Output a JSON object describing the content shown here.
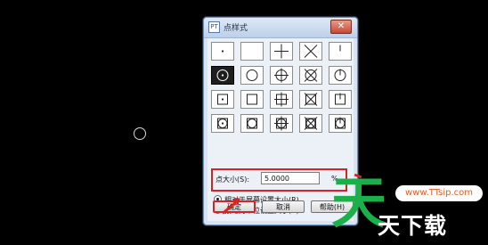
{
  "dialog": {
    "title": "点样式",
    "close_glyph": "✕",
    "icon_glyph": "PT"
  },
  "point_styles": {
    "selected_index": 5,
    "items": [
      "dot",
      "none",
      "plus",
      "x-cross",
      "tick",
      "circle-dot",
      "circle",
      "circle-plus",
      "circle-x",
      "circle-tick",
      "square-dot",
      "square",
      "square-plus",
      "square-x",
      "square-tick",
      "square-circle-dot",
      "square-circle",
      "square-circle-plus",
      "square-circle-x",
      "square-circle-tick"
    ]
  },
  "point_size": {
    "label": "点大小(S):",
    "value": "5.0000",
    "unit": "%"
  },
  "options": {
    "relative_label": "相对于屏幕设置大小(R)",
    "absolute_label": "按绝对单位设置大小(A)",
    "selected": "relative"
  },
  "buttons": {
    "ok": "确定",
    "cancel": "取消",
    "help": "帮助(H)"
  },
  "watermark": {
    "big": "天",
    "url": "www.TTsip.com",
    "small": "天下载"
  },
  "colors": {
    "highlight": "#d92323",
    "watermark_green": "#1ab14a"
  }
}
